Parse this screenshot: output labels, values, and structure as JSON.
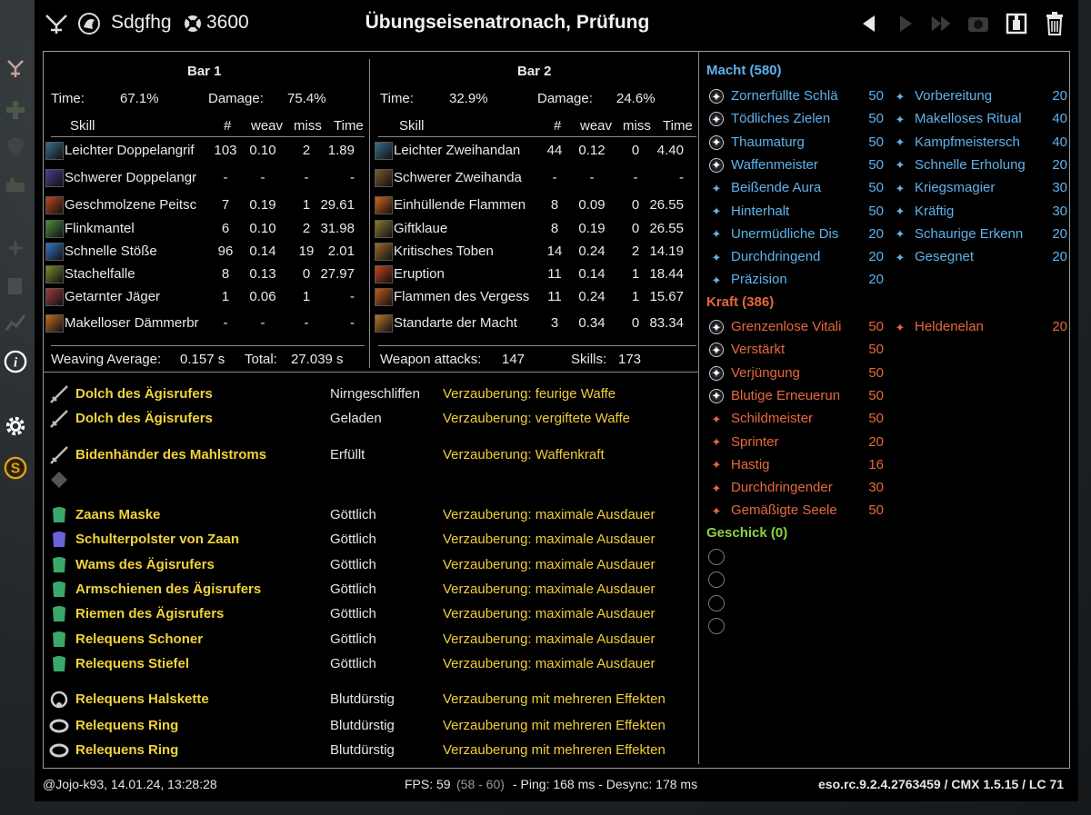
{
  "header": {
    "player_name": "Sdgfhg",
    "player_count": "3600",
    "title": "Übungseisenatronach, Prüfung"
  },
  "bar1": {
    "title": "Bar 1",
    "time_label": "Time:",
    "time_value": "67.1%",
    "damage_label": "Damage:",
    "damage_value": "75.4%",
    "columns": [
      "Skill",
      "#",
      "weav",
      "miss",
      "Time"
    ],
    "rows": [
      {
        "skill": "Leichter Doppelangrif",
        "count": "103",
        "weav": "0.10",
        "miss": "2",
        "time": "1.89",
        "color": "#3a6c8c"
      },
      {
        "skill": "Schwerer Doppelangr",
        "count": "-",
        "weav": "-",
        "miss": "-",
        "time": "-",
        "color": "#4b3c8a"
      },
      {
        "skill": "Geschmolzene Peitsc",
        "count": "7",
        "weav": "0.19",
        "miss": "1",
        "time": "29.61",
        "color": "#c2431b"
      },
      {
        "skill": "Flinkmantel",
        "count": "6",
        "weav": "0.10",
        "miss": "2",
        "time": "31.98",
        "color": "#4c8f3a"
      },
      {
        "skill": "Schnelle Stöße",
        "count": "96",
        "weav": "0.14",
        "miss": "19",
        "time": "2.01",
        "color": "#2e78c4"
      },
      {
        "skill": "Stachelfalle",
        "count": "8",
        "weav": "0.13",
        "miss": "0",
        "time": "27.97",
        "color": "#7a8c2c"
      },
      {
        "skill": "Getarnter Jäger",
        "count": "1",
        "weav": "0.06",
        "miss": "1",
        "time": "-",
        "color": "#a33a3a"
      },
      {
        "skill": "Makelloser Dämmerbr",
        "count": "-",
        "weav": "-",
        "miss": "-",
        "time": "-",
        "color": "#c46a1e"
      }
    ],
    "weaving_label": "Weaving Average:",
    "weaving_value": "0.157 s",
    "total_label": "Total:",
    "total_value": "27.039 s"
  },
  "bar2": {
    "title": "Bar 2",
    "time_label": "Time:",
    "time_value": "32.9%",
    "damage_label": "Damage:",
    "damage_value": "24.6%",
    "columns": [
      "Skill",
      "#",
      "weav",
      "miss",
      "Time"
    ],
    "rows": [
      {
        "skill": "Leichter Zweihandan",
        "count": "44",
        "weav": "0.12",
        "miss": "0",
        "time": "4.40",
        "color": "#3a6c8c"
      },
      {
        "skill": "Schwerer Zweihanda",
        "count": "-",
        "weav": "-",
        "miss": "-",
        "time": "-",
        "color": "#7a5a2c"
      },
      {
        "skill": "Einhüllende Flammen",
        "count": "8",
        "weav": "0.09",
        "miss": "0",
        "time": "26.55",
        "color": "#d4621c"
      },
      {
        "skill": "Giftklaue",
        "count": "8",
        "weav": "0.19",
        "miss": "0",
        "time": "26.55",
        "color": "#8c7a2c"
      },
      {
        "skill": "Kritisches Toben",
        "count": "14",
        "weav": "0.24",
        "miss": "2",
        "time": "14.19",
        "color": "#9c6a2a"
      },
      {
        "skill": "Eruption",
        "count": "11",
        "weav": "0.14",
        "miss": "1",
        "time": "18.44",
        "color": "#c2431b"
      },
      {
        "skill": "Flammen des Vergess",
        "count": "11",
        "weav": "0.24",
        "miss": "1",
        "time": "15.67",
        "color": "#c25a1b"
      },
      {
        "skill": "Standarte der Macht",
        "count": "3",
        "weav": "0.34",
        "miss": "0",
        "time": "83.34",
        "color": "#b8742a"
      }
    ],
    "weapon_attacks_label": "Weapon attacks:",
    "weapon_attacks_value": "147",
    "skills_label": "Skills:",
    "skills_value": "173"
  },
  "gear": [
    {
      "name": "Dolch des Ägisrufers",
      "trait": "Nirngeschliffen",
      "enchant": "Verzauberung: feurige Waffe",
      "icon": "dagger-icon"
    },
    {
      "name": "Dolch des Ägisrufers",
      "trait": "Geladen",
      "enchant": "Verzauberung: vergiftete Waffe",
      "icon": "dagger-icon"
    },
    {
      "name": "Bidenhänder des Mahlstroms",
      "trait": "Erfüllt",
      "enchant": "Verzauberung: Waffenkraft",
      "icon": "sword-icon"
    },
    {
      "name": "",
      "trait": "",
      "enchant": "",
      "icon": "empty-slot-icon"
    },
    {
      "name": "Zaans Maske",
      "trait": "Göttlich",
      "enchant": "Verzauberung: maximale Ausdauer",
      "icon": "mask-icon"
    },
    {
      "name": "Schulterpolster von Zaan",
      "trait": "Göttlich",
      "enchant": "Verzauberung: maximale Ausdauer",
      "icon": "shoulder-icon"
    },
    {
      "name": "Wams des Ägisrufers",
      "trait": "Göttlich",
      "enchant": "Verzauberung: maximale Ausdauer",
      "icon": "chest-icon"
    },
    {
      "name": "Armschienen des Ägisrufers",
      "trait": "Göttlich",
      "enchant": "Verzauberung: maximale Ausdauer",
      "icon": "bracer-icon"
    },
    {
      "name": "Riemen des Ägisrufers",
      "trait": "Göttlich",
      "enchant": "Verzauberung: maximale Ausdauer",
      "icon": "belt-icon"
    },
    {
      "name": "Relequens Schoner",
      "trait": "Göttlich",
      "enchant": "Verzauberung: maximale Ausdauer",
      "icon": "legs-icon"
    },
    {
      "name": "Relequens Stiefel",
      "trait": "Göttlich",
      "enchant": "Verzauberung: maximale Ausdauer",
      "icon": "boots-icon"
    },
    {
      "name": "Relequens Halskette",
      "trait": "Blutdürstig",
      "enchant": "Verzauberung mit mehreren Effekten",
      "icon": "necklace-icon"
    },
    {
      "name": "Relequens Ring",
      "trait": "Blutdürstig",
      "enchant": "Verzauberung mit mehreren Effekten",
      "icon": "ring-icon"
    },
    {
      "name": "Relequens Ring",
      "trait": "Blutdürstig",
      "enchant": "Verzauberung mit mehreren Effekten",
      "icon": "ring-icon"
    }
  ],
  "cp": {
    "macht": {
      "title": "Macht (580)",
      "color": "#5fb2ec",
      "left": [
        {
          "name": "Zornerfüllte Schlä",
          "value": "50",
          "slotted": true
        },
        {
          "name": "Tödliches Zielen",
          "value": "50",
          "slotted": true
        },
        {
          "name": "Thaumaturg",
          "value": "50",
          "slotted": true
        },
        {
          "name": "Waffenmeister",
          "value": "50",
          "slotted": true
        },
        {
          "name": "Beißende Aura",
          "value": "50",
          "slotted": false
        },
        {
          "name": "Hinterhalt",
          "value": "50",
          "slotted": false
        },
        {
          "name": "Unermüdliche Dis",
          "value": "20",
          "slotted": false
        },
        {
          "name": "Durchdringend",
          "value": "20",
          "slotted": false
        },
        {
          "name": "Präzision",
          "value": "20",
          "slotted": false
        }
      ],
      "right": [
        {
          "name": "Vorbereitung",
          "value": "20"
        },
        {
          "name": "Makelloses Ritual",
          "value": "40"
        },
        {
          "name": "Kampfmeistersch",
          "value": "40"
        },
        {
          "name": "Schnelle Erholung",
          "value": "20"
        },
        {
          "name": "Kriegsmagier",
          "value": "30"
        },
        {
          "name": "Kräftig",
          "value": "30"
        },
        {
          "name": "Schaurige Erkenn",
          "value": "20"
        },
        {
          "name": "Gesegnet",
          "value": "20"
        }
      ]
    },
    "kraft": {
      "title": "Kraft (386)",
      "color": "#e8673e",
      "left": [
        {
          "name": "Grenzenlose Vitali",
          "value": "50",
          "slotted": true
        },
        {
          "name": "Verstärkt",
          "value": "50",
          "slotted": true
        },
        {
          "name": "Verjüngung",
          "value": "50",
          "slotted": true
        },
        {
          "name": "Blutige Erneuerun",
          "value": "50",
          "slotted": true
        },
        {
          "name": "Schildmeister",
          "value": "50",
          "slotted": false
        },
        {
          "name": "Sprinter",
          "value": "20",
          "slotted": false
        },
        {
          "name": "Hastig",
          "value": "16",
          "slotted": false
        },
        {
          "name": "Durchdringender",
          "value": "30",
          "slotted": false
        },
        {
          "name": "Gemäßigte Seele",
          "value": "50",
          "slotted": false
        }
      ],
      "right": [
        {
          "name": "Heldenelan",
          "value": "20"
        }
      ]
    },
    "geschick": {
      "title": "Geschick (0)",
      "color": "#8bd24a"
    }
  },
  "footer": {
    "user": "@Jojo-k93, 14.01.24, 13:28:28",
    "fps_label": "FPS: 59",
    "fps_range": "(58 - 60)",
    "ping": "- Ping: 168 ms - Desync: 178 ms",
    "version": "eso.rc.9.2.4.2763459 / CMX 1.5.15 / LC 71"
  }
}
